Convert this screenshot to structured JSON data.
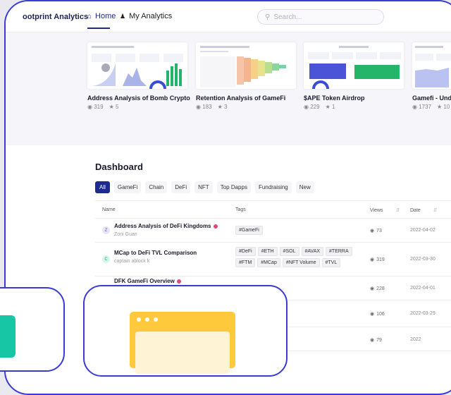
{
  "topbar": {
    "brand": "ootprint Analytics",
    "nav_home": "Home",
    "nav_my": "My Analytics",
    "search_placeholder": "Search..."
  },
  "cards": [
    {
      "title": "Address Analysis of Bomb Crypto",
      "views": "319",
      "stars": "5"
    },
    {
      "title": "Retention Analysis of GameFi",
      "views": "183",
      "stars": "3"
    },
    {
      "title": "$APE Token Airdrop",
      "views": "229",
      "stars": "1"
    },
    {
      "title": "Gamefi - Under",
      "views": "1737",
      "stars": "10"
    }
  ],
  "dashboard": {
    "title": "Dashboard",
    "tabs": [
      "All",
      "GameFi",
      "Chain",
      "DeFi",
      "NFT",
      "Top Dapps",
      "Fundraising",
      "New"
    ],
    "columns": {
      "name": "Name",
      "tags": "Tags",
      "views": "Views",
      "date": "Date"
    },
    "rows": [
      {
        "avatar": "Z",
        "name": "Address Analysis of DeFi Kingdoms",
        "author": "Zoni Guan",
        "tags": [
          "#GameFi"
        ],
        "views": "73",
        "date": "2022-04-02"
      },
      {
        "avatar": "C",
        "name": "MCap to DeFi TVL Comparison",
        "author": "captain ablock k",
        "tags": [
          "#DeFi",
          "#ETH",
          "#SOL",
          "#AVAX",
          "#TERRA",
          "#FTM",
          "#MCap",
          "#NFT Volume",
          "#TVL"
        ],
        "views": "319",
        "date": "2022-03-30"
      },
      {
        "avatar": "",
        "name": "DFK GameFi Overview",
        "author": "",
        "tags": [],
        "views": "228",
        "date": "2022-04-01"
      },
      {
        "avatar": "",
        "name": "",
        "author": "",
        "tags": [],
        "views": "106",
        "date": "2022-03-29"
      },
      {
        "avatar": "",
        "name": "",
        "author": "",
        "tags": [],
        "views": "79",
        "date": "2022"
      }
    ]
  },
  "colors": {
    "primary": "#1d2a8f",
    "frame": "#3a3ad6",
    "accent_green": "#16c6a4",
    "accent_yellow": "#ffc93c"
  }
}
